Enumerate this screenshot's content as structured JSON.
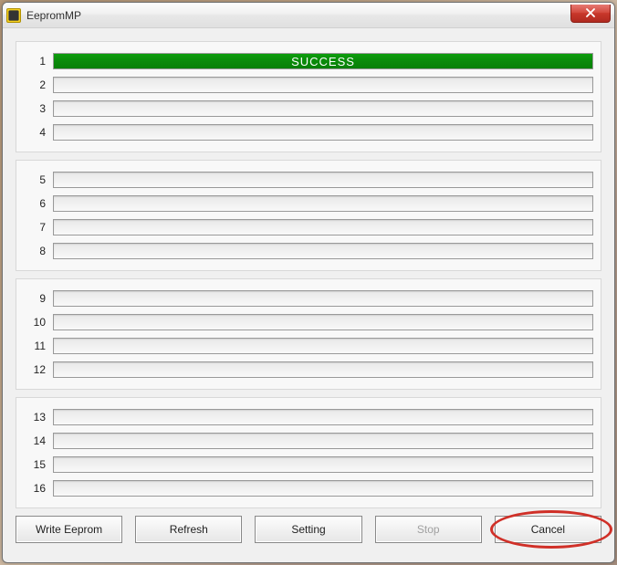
{
  "window": {
    "title": "EepromMP"
  },
  "groups": [
    {
      "rows": [
        {
          "num": "1",
          "status": "SUCCESS",
          "percent": 100
        },
        {
          "num": "2",
          "status": "",
          "percent": 0
        },
        {
          "num": "3",
          "status": "",
          "percent": 0
        },
        {
          "num": "4",
          "status": "",
          "percent": 0
        }
      ]
    },
    {
      "rows": [
        {
          "num": "5",
          "status": "",
          "percent": 0
        },
        {
          "num": "6",
          "status": "",
          "percent": 0
        },
        {
          "num": "7",
          "status": "",
          "percent": 0
        },
        {
          "num": "8",
          "status": "",
          "percent": 0
        }
      ]
    },
    {
      "rows": [
        {
          "num": "9",
          "status": "",
          "percent": 0
        },
        {
          "num": "10",
          "status": "",
          "percent": 0
        },
        {
          "num": "11",
          "status": "",
          "percent": 0
        },
        {
          "num": "12",
          "status": "",
          "percent": 0
        }
      ]
    },
    {
      "rows": [
        {
          "num": "13",
          "status": "",
          "percent": 0
        },
        {
          "num": "14",
          "status": "",
          "percent": 0
        },
        {
          "num": "15",
          "status": "",
          "percent": 0
        },
        {
          "num": "16",
          "status": "",
          "percent": 0
        }
      ]
    }
  ],
  "buttons": {
    "write": "Write Eeprom",
    "refresh": "Refresh",
    "setting": "Setting",
    "stop": "Stop",
    "cancel": "Cancel"
  },
  "colors": {
    "success_fill": "#0a8a0a",
    "highlight_ring": "#d03028"
  }
}
